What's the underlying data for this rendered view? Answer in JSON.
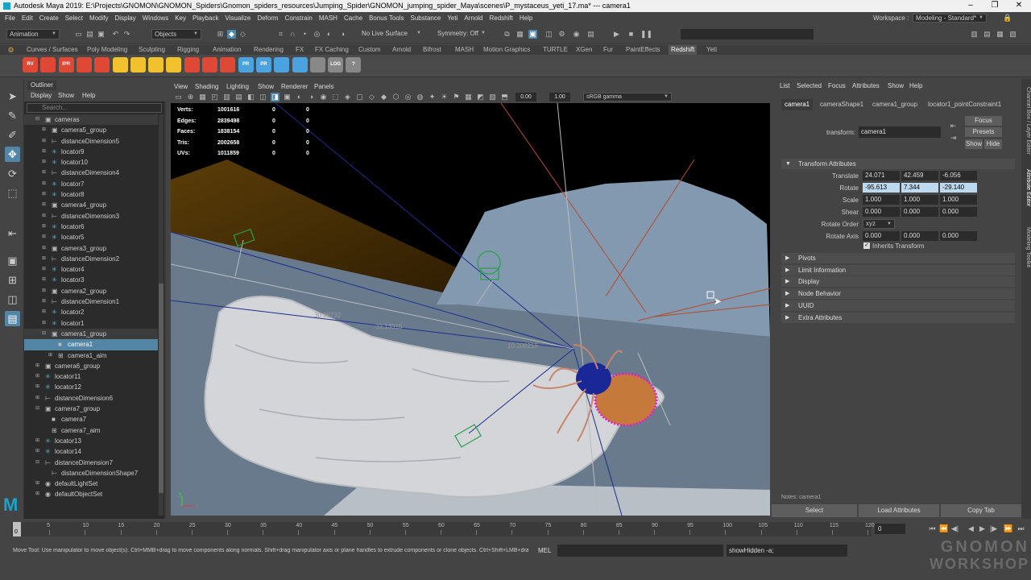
{
  "titlebar": {
    "title": "Autodesk Maya 2019: E:\\Projects\\GNOMON\\GNOMON_Spiders\\Gnomon_spiders_resources\\Jumping_Spider\\GNOMON_jumping_spider_Maya\\scenes\\P_mystaceus_yeti_17.ma*  ---  camera1"
  },
  "menubar": {
    "items": [
      "File",
      "Edit",
      "Create",
      "Select",
      "Modify",
      "Display",
      "Windows",
      "Key",
      "Playback",
      "Visualize",
      "Deform",
      "Constrain",
      "MASH",
      "Cache",
      "Bonus Tools",
      "Substance",
      "Yeti",
      "Arnold",
      "Redshift",
      "Help"
    ],
    "workspace_label": "Workspace :",
    "workspace_value": "Modeling - Standard*"
  },
  "statusline": {
    "menuset": "Animation",
    "select_mode": "Objects",
    "live_surface": "No Live Surface",
    "symmetry": "Symmetry: Off"
  },
  "shelf": {
    "tabs": [
      "Curves / Surfaces",
      "Poly Modeling",
      "Sculpting",
      "Rigging",
      "Animation",
      "Rendering",
      "FX",
      "FX Caching",
      "Custom",
      "Arnold",
      "Bifrost",
      "MASH",
      "Motion Graphics",
      "TURTLE",
      "XGen",
      "Fur",
      "PaintEffects",
      "Redshift",
      "Yeti"
    ],
    "active_tab": "Redshift",
    "icons": [
      {
        "name": "rs-rv-icon",
        "label": "RV",
        "color": "#e04836"
      },
      {
        "name": "rs-render-icon",
        "label": "",
        "color": "#e04836"
      },
      {
        "name": "rs-ipr-icon",
        "label": "IPR",
        "color": "#e04836"
      },
      {
        "name": "rs-ipr-stop-icon",
        "label": "",
        "color": "#e04836"
      },
      {
        "name": "rs-settings-icon",
        "label": "",
        "color": "#e04836"
      },
      {
        "name": "rs-light-icon",
        "label": "",
        "color": "#f2c12e"
      },
      {
        "name": "rs-area-light-icon",
        "label": "",
        "color": "#f2c12e"
      },
      {
        "name": "rs-dome-light-icon",
        "label": "",
        "color": "#f2c12e"
      },
      {
        "name": "rs-sun-icon",
        "label": "",
        "color": "#f2c12e"
      },
      {
        "name": "rs-material-icon",
        "label": "",
        "color": "#e04836"
      },
      {
        "name": "rs-mesh-icon",
        "label": "",
        "color": "#e04836"
      },
      {
        "name": "rs-sphere-icon",
        "label": "",
        "color": "#e04836"
      },
      {
        "name": "rs-proxy-icon",
        "label": "PR",
        "color": "#4aa3df"
      },
      {
        "name": "rs-proxy2-icon",
        "label": "PR",
        "color": "#4aa3df"
      },
      {
        "name": "rs-volume-icon",
        "label": "",
        "color": "#4aa3df"
      },
      {
        "name": "rs-env-icon",
        "label": "",
        "color": "#4aa3df"
      },
      {
        "name": "rs-script-icon",
        "label": "",
        "color": "#888888"
      },
      {
        "name": "rs-log-icon",
        "label": "LOG",
        "color": "#888888"
      },
      {
        "name": "rs-help-icon",
        "label": "?",
        "color": "#888888"
      }
    ]
  },
  "outliner": {
    "title": "Outliner",
    "menu": [
      "Display",
      "Show",
      "Help"
    ],
    "search_placeholder": "Search...",
    "rows": [
      {
        "label": "cameras",
        "indent": 0,
        "type": "group",
        "expanded": true,
        "selected": false,
        "hl": true
      },
      {
        "label": "camera5_group",
        "indent": 1,
        "type": "group",
        "expanded": false
      },
      {
        "label": "distanceDimension5",
        "indent": 1,
        "type": "dim",
        "expanded": false
      },
      {
        "label": "locator9",
        "indent": 1,
        "type": "loc",
        "expanded": false
      },
      {
        "label": "locator10",
        "indent": 1,
        "type": "loc",
        "expanded": false
      },
      {
        "label": "distanceDimension4",
        "indent": 1,
        "type": "dim",
        "expanded": false
      },
      {
        "label": "locator7",
        "indent": 1,
        "type": "loc",
        "expanded": false
      },
      {
        "label": "locator8",
        "indent": 1,
        "type": "loc",
        "expanded": false
      },
      {
        "label": "camera4_group",
        "indent": 1,
        "type": "group",
        "expanded": false
      },
      {
        "label": "distanceDimension3",
        "indent": 1,
        "type": "dim",
        "expanded": false
      },
      {
        "label": "locator6",
        "indent": 1,
        "type": "loc",
        "expanded": false
      },
      {
        "label": "locator5",
        "indent": 1,
        "type": "loc",
        "expanded": false
      },
      {
        "label": "camera3_group",
        "indent": 1,
        "type": "group",
        "expanded": false
      },
      {
        "label": "distanceDimension2",
        "indent": 1,
        "type": "dim",
        "expanded": false
      },
      {
        "label": "locator4",
        "indent": 1,
        "type": "loc",
        "expanded": false
      },
      {
        "label": "locator3",
        "indent": 1,
        "type": "loc",
        "expanded": false
      },
      {
        "label": "camera2_group",
        "indent": 1,
        "type": "group",
        "expanded": false
      },
      {
        "label": "distanceDimension1",
        "indent": 1,
        "type": "dim",
        "expanded": false
      },
      {
        "label": "locator2",
        "indent": 1,
        "type": "loc",
        "expanded": false
      },
      {
        "label": "locator1",
        "indent": 1,
        "type": "loc",
        "expanded": false
      },
      {
        "label": "camera1_group",
        "indent": 1,
        "type": "group",
        "expanded": true,
        "hl": true
      },
      {
        "label": "camera1",
        "indent": 2,
        "type": "cam",
        "selected": true
      },
      {
        "label": "camera1_aim",
        "indent": 2,
        "type": "aim",
        "expanded": false
      },
      {
        "label": "camera6_group",
        "indent": 0,
        "type": "group",
        "expanded": false
      },
      {
        "label": "locator11",
        "indent": 0,
        "type": "loc",
        "expanded": false
      },
      {
        "label": "locator12",
        "indent": 0,
        "type": "loc",
        "expanded": false
      },
      {
        "label": "distanceDimension6",
        "indent": 0,
        "type": "dim",
        "expanded": false
      },
      {
        "label": "camera7_group",
        "indent": 0,
        "type": "group",
        "expanded": true
      },
      {
        "label": "camera7",
        "indent": 1,
        "type": "cam"
      },
      {
        "label": "camera7_aim",
        "indent": 1,
        "type": "aim"
      },
      {
        "label": "locator13",
        "indent": 0,
        "type": "loc",
        "expanded": false
      },
      {
        "label": "locator14",
        "indent": 0,
        "type": "loc",
        "expanded": false
      },
      {
        "label": "distanceDimension7",
        "indent": 0,
        "type": "dim",
        "expanded": true
      },
      {
        "label": "distanceDimensionShape7",
        "indent": 1,
        "type": "dim"
      },
      {
        "label": "defaultLightSet",
        "indent": 0,
        "type": "set",
        "expanded": false
      },
      {
        "label": "defaultObjectSet",
        "indent": 0,
        "type": "set",
        "expanded": false
      }
    ]
  },
  "viewport": {
    "menu": [
      "View",
      "Shading",
      "Lighting",
      "Show",
      "Renderer",
      "Panels"
    ],
    "exposure": "0.00",
    "gamma": "1.00",
    "colorspace": "sRGB gamma",
    "hud": [
      {
        "label": "Verts:",
        "v1": "1001616",
        "v2": "0",
        "v3": "0"
      },
      {
        "label": "Edges:",
        "v1": "2839498",
        "v2": "0",
        "v3": "0"
      },
      {
        "label": "Faces:",
        "v1": "1838154",
        "v2": "0",
        "v3": "0"
      },
      {
        "label": "Tris:",
        "v1": "2002658",
        "v2": "0",
        "v3": "0"
      },
      {
        "label": "UVs:",
        "v1": "1011859",
        "v2": "0",
        "v3": "0"
      }
    ],
    "distance_labels": [
      "33.13315",
      "10.200218",
      "30.29732"
    ]
  },
  "attribute_editor": {
    "menu": [
      "List",
      "Selected",
      "Focus",
      "Attributes",
      "Show",
      "Help"
    ],
    "tabs": [
      "camera1",
      "cameraShape1",
      "camera1_group",
      "locator1_pointConstraint1"
    ],
    "active_tab": "camera1",
    "transform_label": "transform:",
    "transform_value": "camera1",
    "focus_btn": "Focus",
    "presets_btn": "Presets",
    "show_btn": "Show",
    "hide_btn": "Hide",
    "section_transform": "Transform Attributes",
    "translate_label": "Translate",
    "translate": [
      "24.071",
      "42.459",
      "-6.056"
    ],
    "rotate_label": "Rotate",
    "rotate": [
      "-95.613",
      "7.344",
      "-29.140"
    ],
    "scale_label": "Scale",
    "scale": [
      "1.000",
      "1.000",
      "1.000"
    ],
    "shear_label": "Shear",
    "shear": [
      "0.000",
      "0.000",
      "0.000"
    ],
    "rotate_order_label": "Rotate Order",
    "rotate_order": "xyz",
    "rotate_axis_label": "Rotate Axis",
    "rotate_axis": [
      "0.000",
      "0.000",
      "0.000"
    ],
    "inherits_transform": "Inherits Transform",
    "sections": [
      "Pivots",
      "Limit Information",
      "Display",
      "Node Behavior",
      "UUID",
      "Extra Attributes"
    ],
    "notes_label": "Notes: camera1",
    "select_btn": "Select",
    "load_attr_btn": "Load Attributes",
    "copy_tab_btn": "Copy Tab"
  },
  "side_tabs": [
    "Channel Box / Layer Editor",
    "Attribute Editor",
    "Modeling Toolkit"
  ],
  "timeline": {
    "ticks": [
      "0",
      "5",
      "10",
      "15",
      "20",
      "25",
      "30",
      "35",
      "40",
      "45",
      "50",
      "55",
      "60",
      "65",
      "70",
      "75",
      "80",
      "85",
      "90",
      "95",
      "100",
      "105",
      "110",
      "115",
      "120"
    ],
    "current_frame": "0",
    "frame_field": "0"
  },
  "commandline": {
    "help_text": "Move Tool: Use manipulator to move object(s). Ctrl+MMB+drag to move components along normals. Shift+drag manipulator axis or plane handles to extrude components or clone objects. Ctrl+Shift+LMB+drag to cc",
    "mel_label": "MEL",
    "result": "showHidden -a;"
  },
  "watermark": {
    "line1": "GNOMON",
    "line2": "WORKSHOP"
  }
}
